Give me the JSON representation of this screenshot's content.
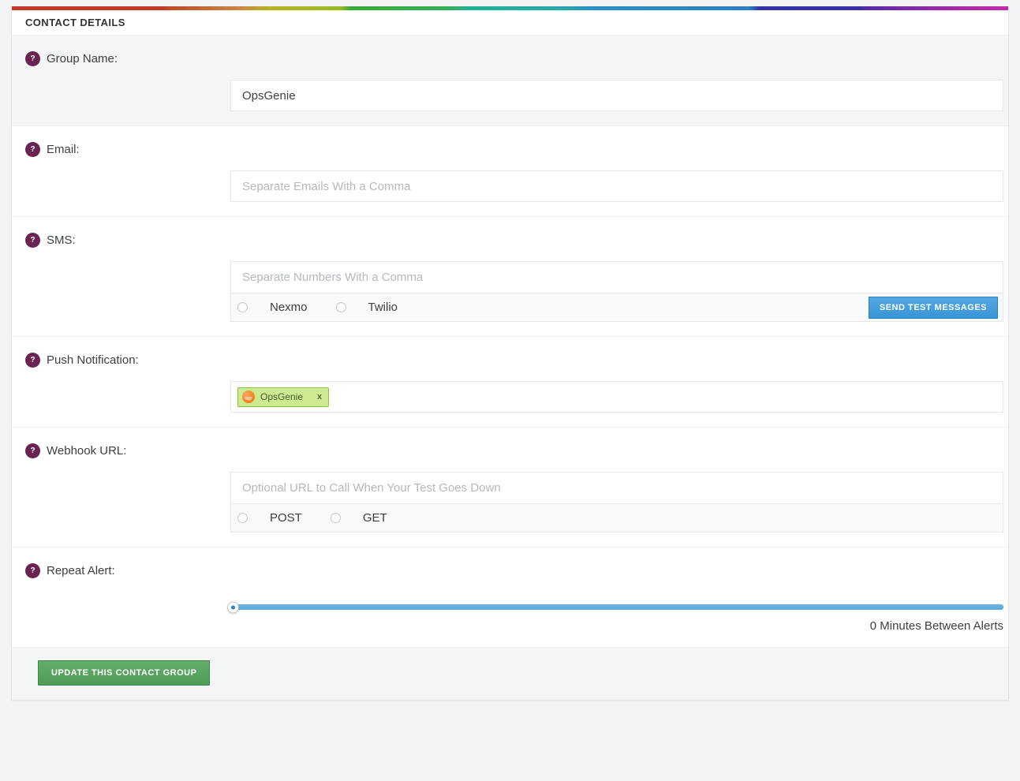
{
  "card": {
    "header_title": "CONTACT DETAILS",
    "accent_blue": "#3a94d6",
    "accent_green": "#4e9c58",
    "help_icon_color": "#6b2452",
    "help_icon_glyph": "?"
  },
  "rows": {
    "group_name": {
      "label": "Group Name:",
      "input_value": "OpsGenie",
      "input_placeholder": ""
    },
    "email": {
      "label": "Email:",
      "input_value": "",
      "input_placeholder": "Separate Emails With a Comma"
    },
    "sms": {
      "label": "SMS:",
      "input_value": "",
      "input_placeholder": "Separate Numbers With a Comma",
      "providers": [
        {
          "label": "Nexmo",
          "selected": false
        },
        {
          "label": "Twilio",
          "selected": false
        }
      ],
      "test_button_label": "SEND TEST MESSAGES"
    },
    "push_notification": {
      "label": "Push Notification:",
      "chips": [
        {
          "label": "OpsGenie",
          "remove_label": "x",
          "logo": "opsgenie-logo-icon"
        }
      ]
    },
    "webhook_url": {
      "label": "Webhook URL:",
      "input_value": "",
      "input_placeholder": "Optional URL to Call When Your Test Goes Down",
      "methods": [
        {
          "label": "POST",
          "selected": false
        },
        {
          "label": "GET",
          "selected": false
        }
      ]
    },
    "repeat_alert": {
      "label": "Repeat Alert:",
      "slider_value": 0,
      "slider_min": 0,
      "slider_max": 60,
      "caption": "0 Minutes Between Alerts"
    }
  },
  "footer": {
    "update_button_label": "UPDATE THIS CONTACT GROUP"
  }
}
